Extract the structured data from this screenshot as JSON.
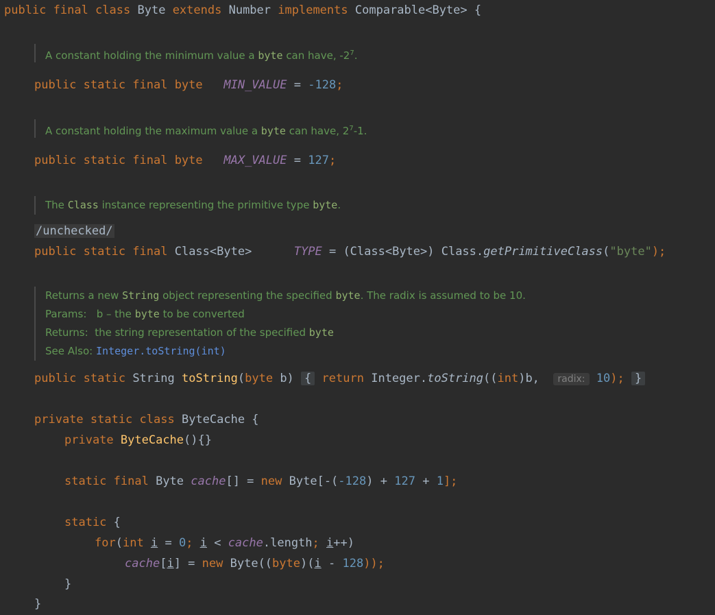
{
  "colors": {
    "background": "#2b2b2b",
    "keyword": "#cc7832",
    "number": "#6897bb",
    "string": "#6a8759",
    "field": "#9876aa",
    "method": "#ffc66d",
    "doc": "#629755"
  },
  "code": {
    "class_decl": {
      "kw1": "public final class",
      "name": "Byte",
      "kw2": "extends",
      "parent": "Number",
      "kw3": "implements",
      "iface": "Comparable<Byte> {"
    },
    "doc_min": {
      "text": "A constant holding the minimum value a",
      "code": "byte",
      "tail": "can have, -2",
      "sup": "7",
      "end": "."
    },
    "min_line": {
      "mods": "public static final byte",
      "field": "MIN_VALUE",
      "eq": "=",
      "value": "-128",
      "semi": ";"
    },
    "doc_max": {
      "text": "A constant holding the maximum value a",
      "code": "byte",
      "tail": "can have, 2",
      "sup": "7",
      "end": "-1."
    },
    "max_line": {
      "mods": "public static final byte",
      "field": "MAX_VALUE",
      "eq": "=",
      "value": "127",
      "semi": ";"
    },
    "doc_type": {
      "a": "The",
      "code1": "Class",
      "b": "instance representing the primitive type",
      "code2": "byte",
      "end": "."
    },
    "annotation": "/unchecked/",
    "type_line": {
      "mods": "public static final",
      "type": "Class<Byte>",
      "field": "TYPE",
      "eq": "=",
      "cast": "(Class<Byte>) Class.",
      "method": "getPrimitiveClass",
      "arg_open": "(",
      "arg": "\"byte\"",
      "arg_close": ");"
    },
    "doc_tostring": {
      "l1a": "Returns a new",
      "l1code": "String",
      "l1b": "object representing the specified",
      "l1code2": "byte",
      "l1c": ". The radix is assumed to be 10.",
      "params_label": "Params:",
      "params_a": "b – the",
      "params_code": "byte",
      "params_b": "to be converted",
      "returns_label": "Returns:",
      "returns_a": "the string representation of the specified",
      "returns_code": "byte",
      "see_label": "See Also:",
      "see_link": "Integer.toString(int)"
    },
    "tostring_line": {
      "mods": "public static",
      "type": "String",
      "name": "toString",
      "params_open": "(",
      "ptype": "byte",
      "pname": " b)",
      "brace": "{",
      "ret": "return",
      "call": "Integer.",
      "call_m": "toString",
      "args": "((",
      "cast_t": "int",
      "args2": ")b,",
      "hint": "radix:",
      "num": "10",
      "end": ");",
      "close": "}"
    },
    "cache_class": {
      "mods": "private static class",
      "name": "ByteCache {"
    },
    "cache_ctor": {
      "mod": "private",
      "name": "ByteCache",
      "rest": "(){}"
    },
    "cache_arr": {
      "mods": "static final",
      "type": "Byte",
      "field": "cache",
      "arr": "[] =",
      "kw": "new",
      "t2": "Byte[-(",
      "n1": "-128",
      "m1": ") +",
      "n2": "127",
      "m2": "+",
      "n3": "1",
      "end": "];"
    },
    "static_block": {
      "kw": "static",
      "brace": "{"
    },
    "for_line": {
      "kw": "for",
      "open": "(",
      "int": "int",
      "var": "i",
      "eq": "=",
      "zero": "0",
      "semi1": ";",
      "var2": "i",
      "lt": "<",
      "field": "cache",
      "len": ".length",
      "semi2": ";",
      "var3": "i",
      "inc": "++)"
    },
    "assign_line": {
      "field": "cache",
      "idx_open": "[",
      "var": "i",
      "idx_close": "] =",
      "kw": "new",
      "t": "Byte((",
      "cast": "byte",
      "rest": ")(",
      "var2": "i",
      "minus": "-",
      "n": "128",
      "end": "));"
    },
    "close_inner": "}",
    "close_outer": "}"
  }
}
